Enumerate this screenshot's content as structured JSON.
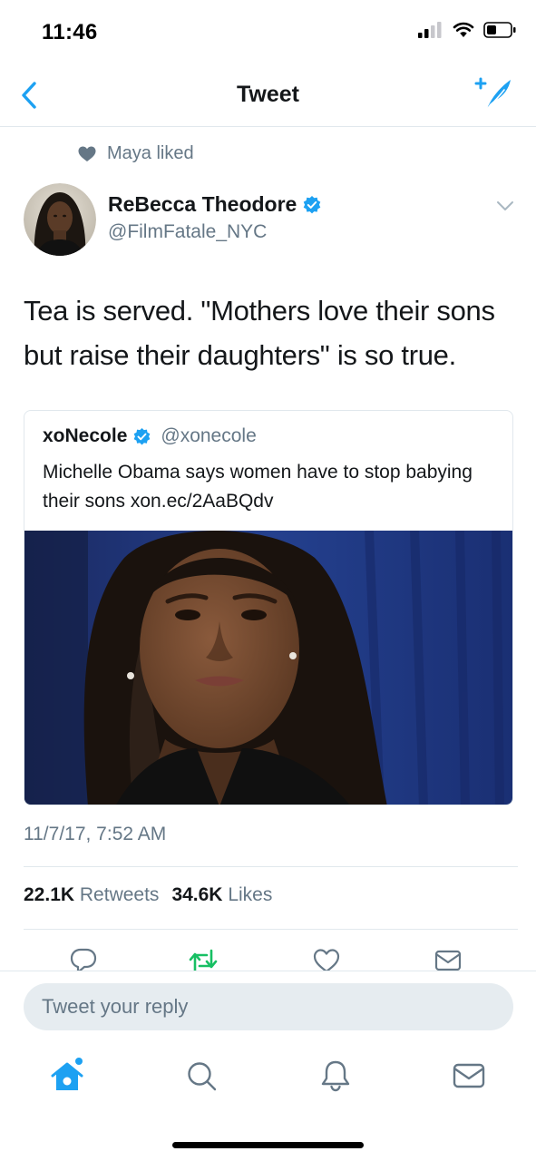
{
  "status_bar": {
    "time": "11:46"
  },
  "nav": {
    "title": "Tweet"
  },
  "social_context": {
    "text": "Maya liked"
  },
  "author": {
    "name": "ReBecca Theodore",
    "handle": "@FilmFatale_NYC",
    "verified": true
  },
  "tweet": {
    "text": "Tea is served. \"Mothers love their sons but raise their daughters\" is so true.",
    "timestamp": "11/7/17, 7:52 AM"
  },
  "quote": {
    "name": "xoNecole",
    "handle": "@xonecole",
    "verified": true,
    "text": "Michelle Obama says women have to stop babying their sons xon.ec/2AaBQdv"
  },
  "stats": {
    "retweets_count": "22.1K",
    "retweets_label": "Retweets",
    "likes_count": "34.6K",
    "likes_label": "Likes"
  },
  "actions": [
    "reply-icon",
    "retweet-icon",
    "like-icon",
    "direct-message-icon"
  ],
  "reply": {
    "placeholder": "Tweet your reply"
  },
  "tabs": [
    "home-icon",
    "search-icon",
    "notifications-icon",
    "messages-icon"
  ],
  "colors": {
    "accent": "#1da1f2",
    "retweet": "#17bf63",
    "secondary_text": "#657786",
    "border": "#e1e8ed"
  }
}
